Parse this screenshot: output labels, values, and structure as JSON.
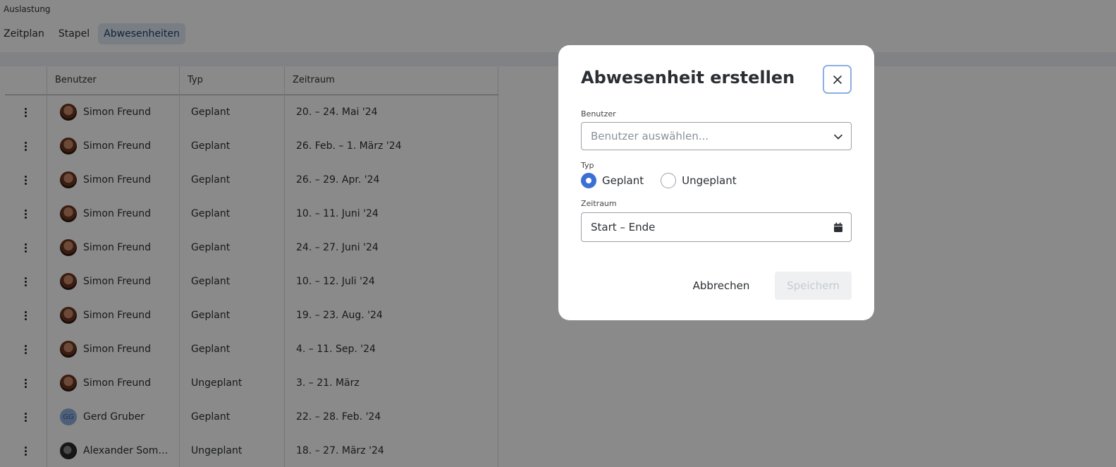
{
  "app": {
    "title": "Auslastung"
  },
  "tabs": [
    {
      "label": "Zeitplan",
      "active": false
    },
    {
      "label": "Stapel",
      "active": false
    },
    {
      "label": "Abwesenheiten",
      "active": true
    }
  ],
  "table": {
    "columns": [
      "",
      "Benutzer",
      "Typ",
      "Zeitraum"
    ],
    "rows": [
      {
        "user": "Simon Freund",
        "avatar": "photo",
        "type": "Geplant",
        "period": "20. – 24. Mai '24"
      },
      {
        "user": "Simon Freund",
        "avatar": "photo",
        "type": "Geplant",
        "period": "26. Feb. – 1. März '24"
      },
      {
        "user": "Simon Freund",
        "avatar": "photo",
        "type": "Geplant",
        "period": "26. – 29. Apr. '24"
      },
      {
        "user": "Simon Freund",
        "avatar": "photo",
        "type": "Geplant",
        "period": "10. – 11. Juni '24"
      },
      {
        "user": "Simon Freund",
        "avatar": "photo",
        "type": "Geplant",
        "period": "24. – 27. Juni '24"
      },
      {
        "user": "Simon Freund",
        "avatar": "photo",
        "type": "Geplant",
        "period": "10. – 12. Juli '24"
      },
      {
        "user": "Simon Freund",
        "avatar": "photo",
        "type": "Geplant",
        "period": "19. – 23. Aug. '24"
      },
      {
        "user": "Simon Freund",
        "avatar": "photo",
        "type": "Geplant",
        "period": "4. – 11. Sep. '24"
      },
      {
        "user": "Simon Freund",
        "avatar": "photo",
        "type": "Ungeplant",
        "period": "3. – 21. März"
      },
      {
        "user": "Gerd Gruber",
        "avatar": "initials",
        "initials": "GG",
        "type": "Geplant",
        "period": "22. – 28. Feb. '24"
      },
      {
        "user": "Alexander Somm...",
        "avatar": "photo2",
        "type": "Ungeplant",
        "period": "18. – 27. März '24"
      }
    ]
  },
  "modal": {
    "title": "Abwesenheit erstellen",
    "user_label": "Benutzer",
    "user_placeholder": "Benutzer auswählen...",
    "type_label": "Typ",
    "type_options": [
      {
        "label": "Geplant",
        "checked": true
      },
      {
        "label": "Ungeplant",
        "checked": false
      }
    ],
    "period_label": "Zeitraum",
    "period_value": "Start – Ende",
    "cancel_label": "Abbrechen",
    "save_label": "Speichern",
    "close_icon": "close-icon",
    "chevron_icon": "chevron-down-icon",
    "calendar_icon": "calendar-icon"
  },
  "colors": {
    "accent": "#3b6fd4",
    "active_tab_bg": "#dfe9f5",
    "overlay": "rgba(0,0,0,0.46)"
  }
}
